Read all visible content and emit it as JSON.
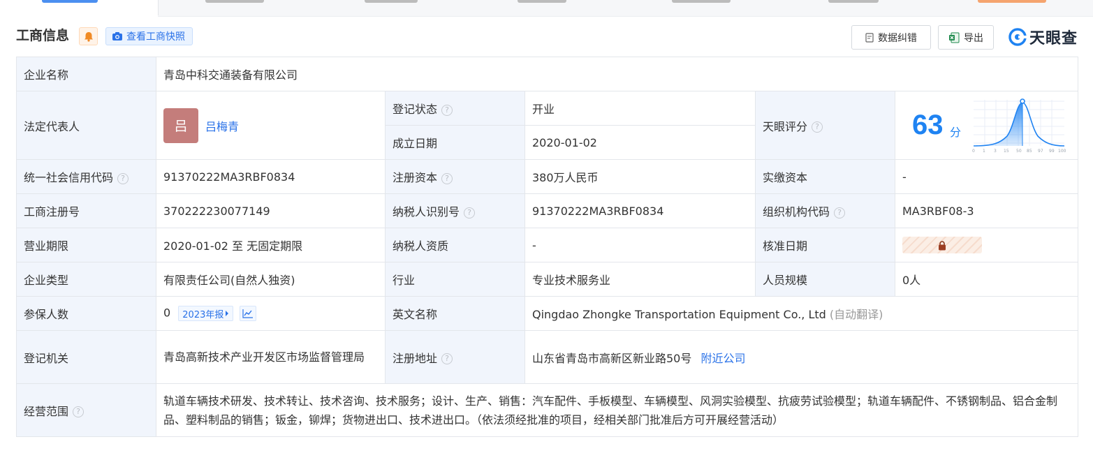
{
  "header": {
    "title": "工商信息",
    "snapshot_label": "查看工商快照",
    "correct_label": "数据纠错",
    "export_label": "导出",
    "brand": "天眼查"
  },
  "colors": {
    "accent_blue": "#2a72e8",
    "score_blue": "#1f83f2",
    "status_green": "#10a33b",
    "key_bg": "#f1f5fc",
    "avatar_bg": "#c47d7b"
  },
  "fields": {
    "company_name_label": "企业名称",
    "company_name": "青岛中科交通装备有限公司",
    "legal_rep_label": "法定代表人",
    "legal_rep_avatar": "吕",
    "legal_rep_name": "吕梅青",
    "reg_status_label": "登记状态",
    "reg_status": "开业",
    "established_label": "成立日期",
    "established": "2020-01-02",
    "score_label": "天眼评分",
    "score": "63",
    "score_unit": "分",
    "credit_code_label": "统一社会信用代码",
    "credit_code": "91370222MA3RBF0834",
    "reg_capital_label": "注册资本",
    "reg_capital": "380万人民币",
    "paid_capital_label": "实缴资本",
    "paid_capital": "-",
    "biz_reg_no_label": "工商注册号",
    "biz_reg_no": "370222230077149",
    "taxpayer_id_label": "纳税人识别号",
    "taxpayer_id": "91370222MA3RBF0834",
    "org_code_label": "组织机构代码",
    "org_code": "MA3RBF08-3",
    "biz_term_label": "营业期限",
    "biz_term": "2020-01-02 至 无固定期限",
    "taxpayer_qual_label": "纳税人资质",
    "taxpayer_qual": "-",
    "approve_date_label": "核准日期",
    "company_type_label": "企业类型",
    "company_type": "有限责任公司(自然人独资)",
    "industry_label": "行业",
    "industry": "专业技术服务业",
    "staff_size_label": "人员规模",
    "staff_size": "0人",
    "insured_label": "参保人数",
    "insured": "0",
    "insured_report": "2023年报",
    "english_name_label": "英文名称",
    "english_name": "Qingdao Zhongke Transportation Equipment Co., Ltd",
    "english_name_note": "(自动翻译)",
    "reg_authority_label": "登记机关",
    "reg_authority": "青岛高新技术产业开发区市场监督管理局",
    "reg_address_label": "注册地址",
    "reg_address": "山东省青岛市高新区新业路50号",
    "nearby_label": "附近公司",
    "scope_label": "经营范围",
    "scope": "轨道车辆技术研发、技术转让、技术咨询、技术服务；设计、生产、销售：汽车配件、手板模型、车辆模型、风洞实验模型、抗疲劳试验模型；轨道车辆配件、不锈钢制品、铝合金制品、塑料制品的销售；钣金，铆焊；货物进出口、技术进出口。（依法须经批准的项目，经相关部门批准后方可开展经营活动）"
  },
  "score_chart": {
    "ticks": [
      "0",
      "1",
      "3",
      "15",
      "50",
      "85",
      "97",
      "99",
      "100"
    ]
  }
}
